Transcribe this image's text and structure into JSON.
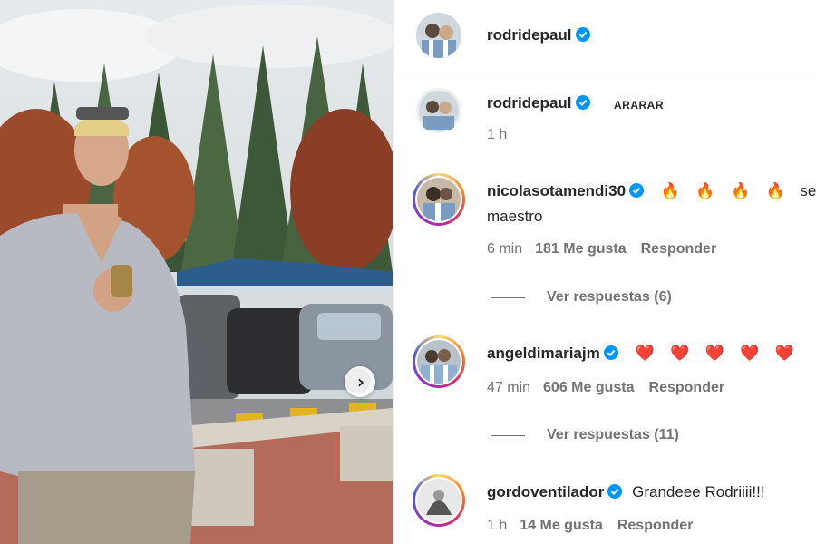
{
  "post": {
    "author": "rodridepaul",
    "caption": "ARARAR",
    "time": "1 h"
  },
  "comments": [
    {
      "username": "nicolasotamendi30",
      "text_emojis": "🔥 🔥 🔥 🔥",
      "text_tail": "see",
      "text_line2": "maestro",
      "time": "6 min",
      "likes": "181 Me gusta",
      "reply": "Responder",
      "replies": "Ver respuestas (6)"
    },
    {
      "username": "angeldimariajm",
      "text_emojis": "❤️ ❤️ ❤️ ❤️ ❤️",
      "time": "47 min",
      "likes": "606 Me gusta",
      "reply": "Responder",
      "replies": "Ver respuestas (11)"
    },
    {
      "username": "gordoventilador",
      "text": "Grandeee Rodriiii!!!",
      "time": "1 h",
      "likes": "14 Me gusta",
      "reply": "Responder"
    }
  ],
  "colors": {
    "verified": "#0095f6",
    "fire": "#f7931e",
    "heart": "#e0245e",
    "muted_text": "#737373"
  },
  "icons": [
    "verified-badge-icon",
    "chevron-right-icon"
  ]
}
